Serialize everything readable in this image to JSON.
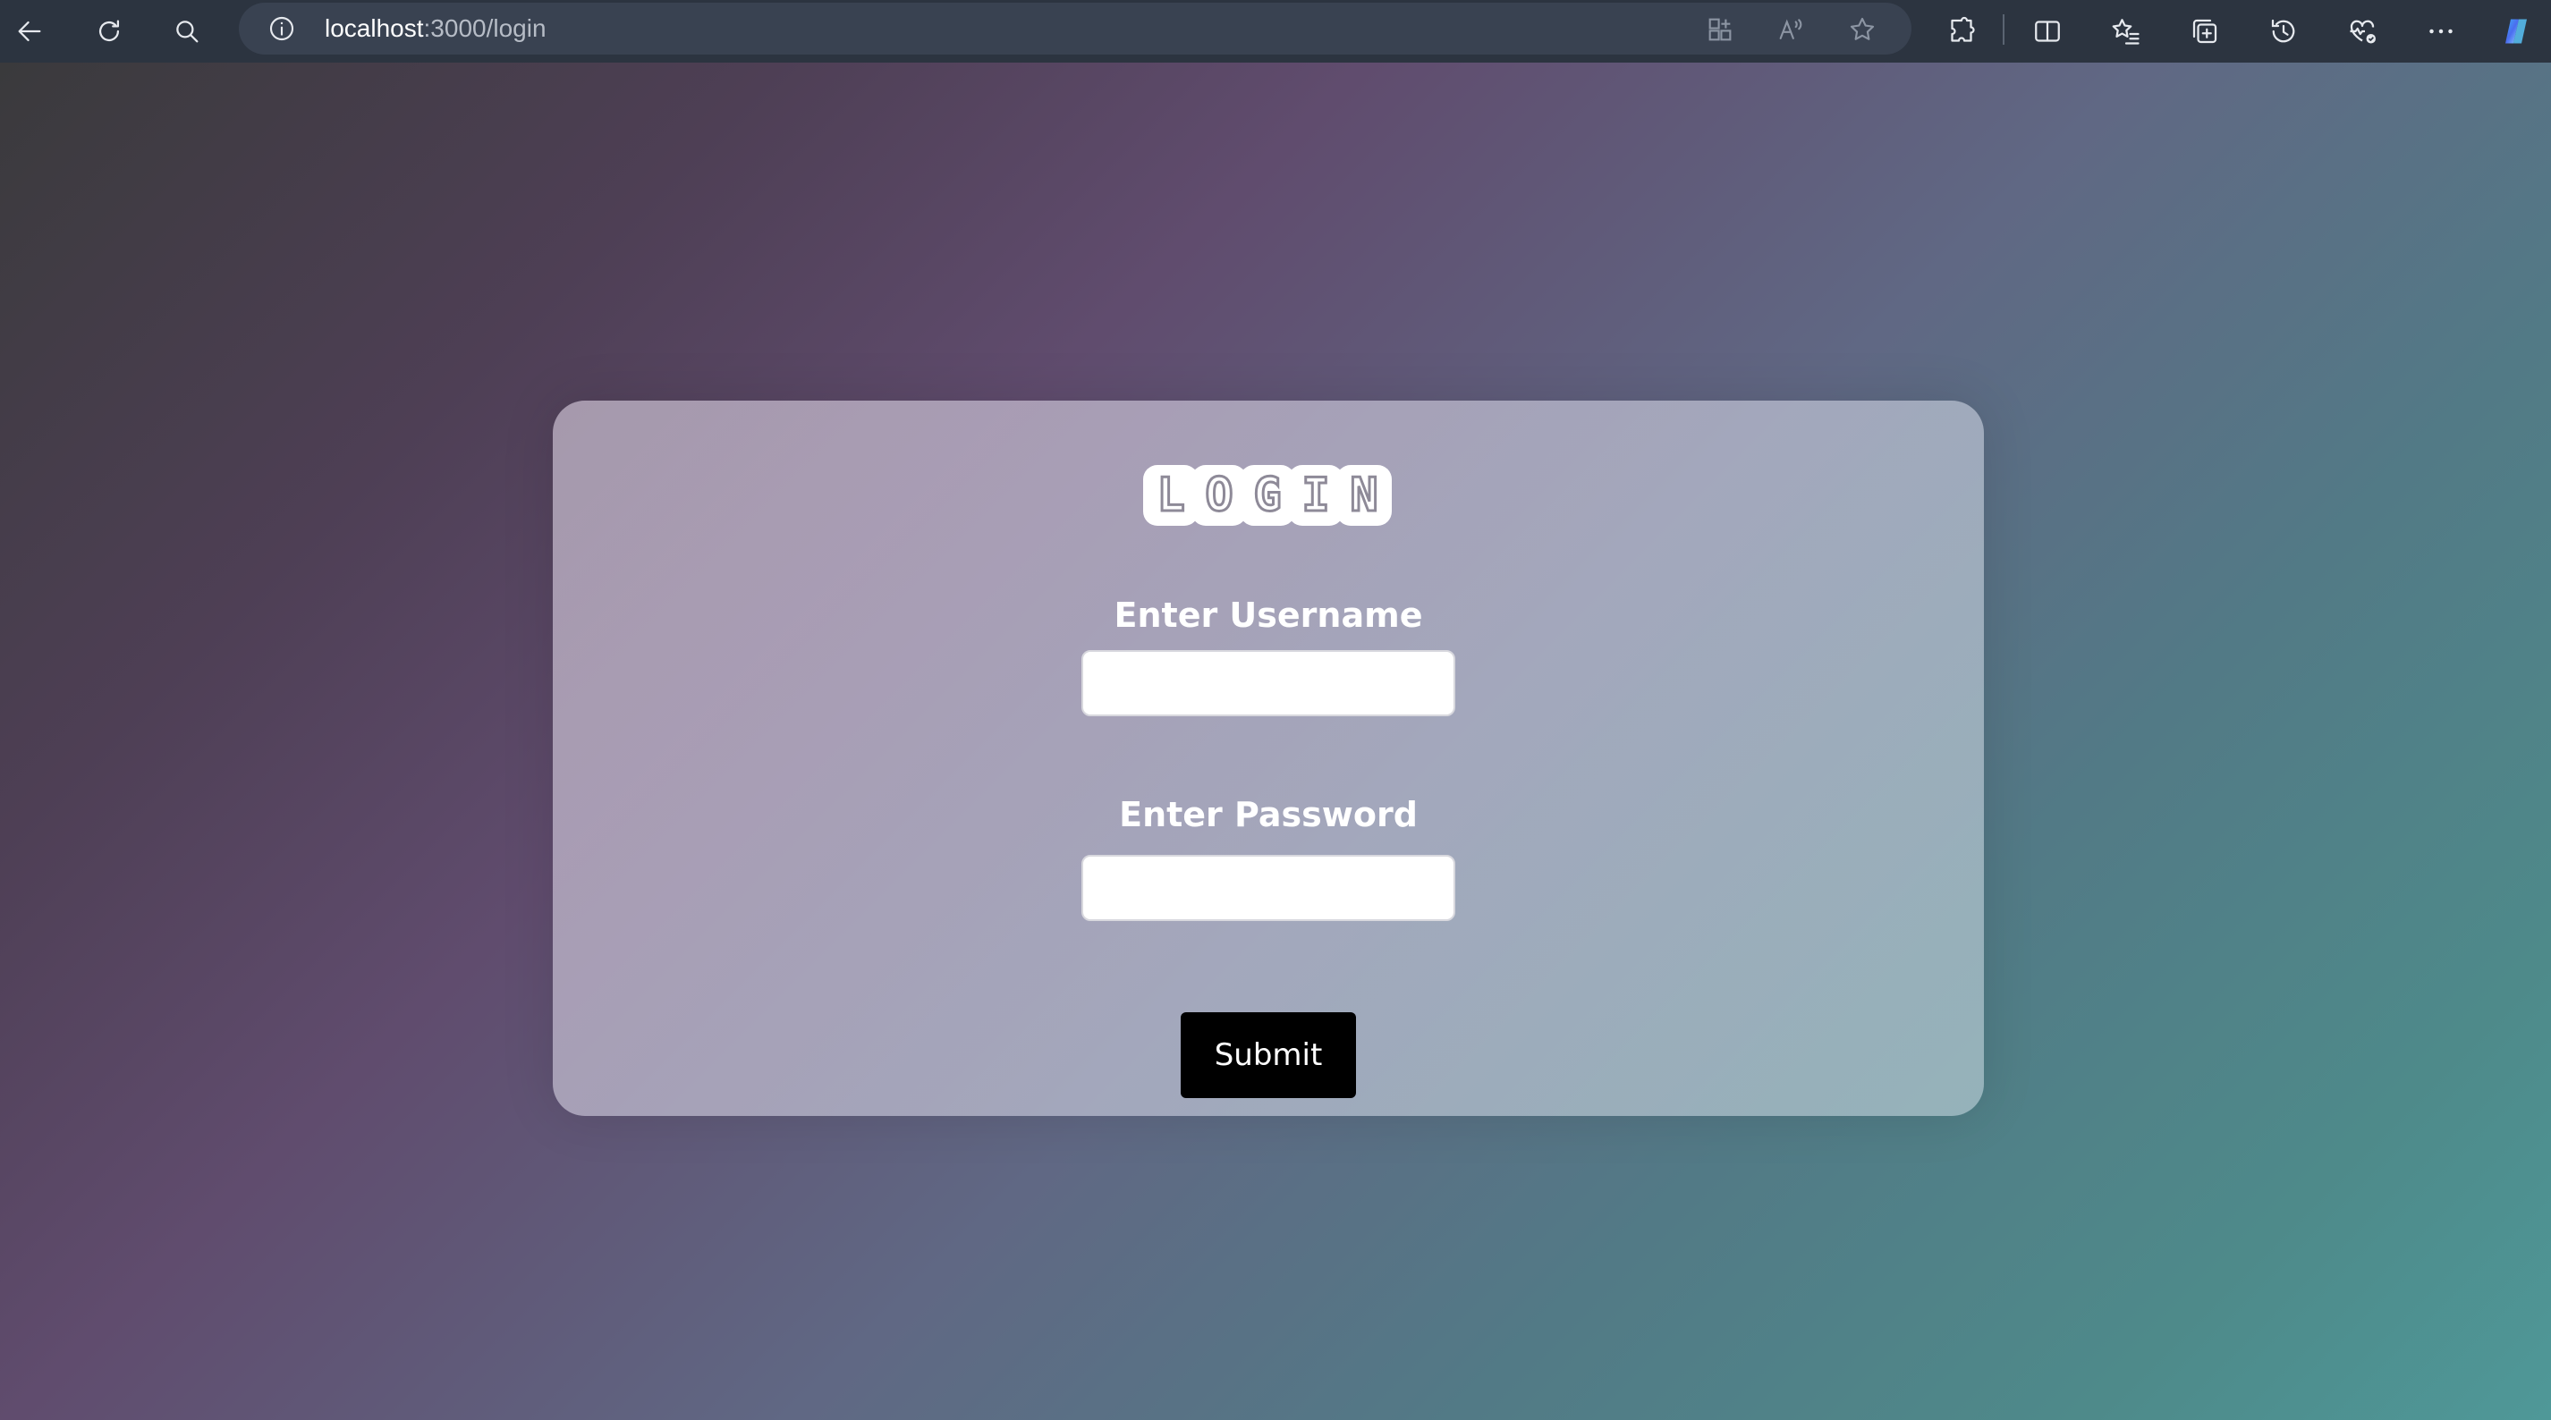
{
  "browser": {
    "url_host": "localhost",
    "url_path": ":3000/login",
    "icons": {
      "back": "back-arrow-icon",
      "reload": "reload-icon",
      "search": "search-icon",
      "site_info": "info-icon",
      "app_available": "app-grid-icon",
      "read_aloud": "read-aloud-icon",
      "favorite": "star-icon",
      "extensions": "puzzle-icon",
      "split_screen": "split-screen-icon",
      "favorites": "favorites-list-icon",
      "collections": "collections-icon",
      "history": "history-icon",
      "browser_essentials": "heart-pulse-icon",
      "more": "more-dots-icon",
      "copilot": "copilot-icon"
    }
  },
  "login": {
    "logo_letters": [
      "L",
      "O",
      "G",
      "I",
      "N"
    ],
    "username_label": "Enter Username",
    "username_value": "",
    "password_label": "Enter Password",
    "password_value": "",
    "submit_label": "Submit"
  },
  "colors": {
    "toolbar_bg": "#2c3440",
    "addressbar_bg": "#394251",
    "button_bg": "#000000",
    "label_color": "#ffffff"
  }
}
